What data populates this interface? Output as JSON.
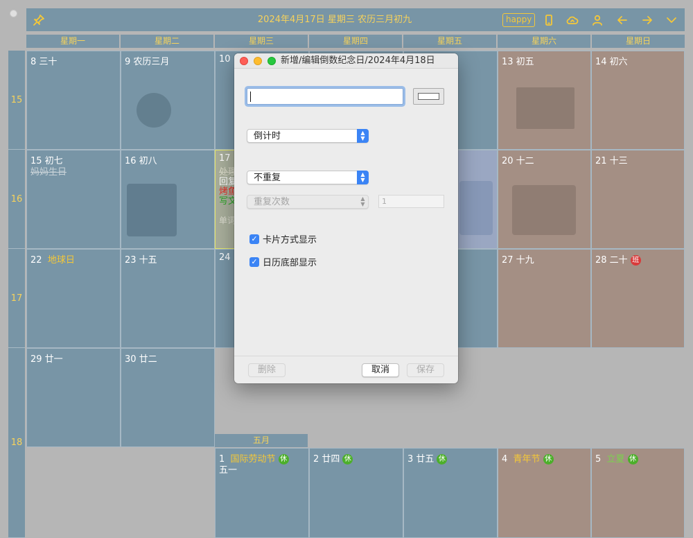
{
  "header": {
    "title": "2024年4月17日 星期三 农历三月初九",
    "happy_label": "happy",
    "icons": [
      "pin-icon",
      "phone-icon",
      "cloud-icon",
      "person-icon",
      "arrow-left-icon",
      "arrow-right-icon",
      "chevron-down-icon"
    ]
  },
  "weekdays": [
    "星期一",
    "星期二",
    "星期三",
    "星期四",
    "星期五",
    "星期六",
    "星期日"
  ],
  "weeks": [
    "15",
    "16",
    "17",
    "18"
  ],
  "cells": {
    "d8": "8  三十",
    "d9": "9  农历三月",
    "d10": "10",
    "d13": "13  初五",
    "d14": "14  初六",
    "d15": "15  初七",
    "d15_event": "妈妈生日",
    "d16": "16  初八",
    "d17": "17",
    "d17_e1": "处理",
    "d17_e2": "回复",
    "d17_e3": "烤鱼",
    "d17_e4": "写文",
    "d17_e5": "单词",
    "d20": "20  十二",
    "d21": "21  十三",
    "d22_num": "22",
    "d22_name": "地球日",
    "d23": "23  十五",
    "d24": "24",
    "d27": "27  十九",
    "d28": "28  二十",
    "d28_tag": "班",
    "d29": "29  廿一",
    "d30": "30  廿二",
    "may_label": "五月",
    "m1_num": "1",
    "m1_name": "国际劳动节",
    "m1_tag": "休",
    "m1_sub": "五一",
    "m2": "2  廿四",
    "m2_tag": "休",
    "m3": "3  廿五",
    "m3_tag": "休",
    "m4_num": "4",
    "m4_name": "青年节",
    "m4_tag": "休",
    "m5_num": "5",
    "m5_name": "立夏",
    "m5_tag": "休"
  },
  "dialog": {
    "title": "新增/编辑倒数纪念日/2024年4月18日",
    "name_value": "",
    "type_select": "倒计时",
    "repeat_select": "不重复",
    "repeat_count_select": "重复次数",
    "repeat_count_value": "1",
    "card_display_label": "卡片方式显示",
    "card_display_checked": true,
    "calendar_bottom_label": "日历底部显示",
    "calendar_bottom_checked": true,
    "delete_label": "删除",
    "cancel_label": "取消",
    "save_label": "保存"
  },
  "colors": {
    "cell_weekday": "#7895a6",
    "cell_weekend": "#a48f84",
    "accent_yellow": "#f5c838",
    "holiday_green": "#4caf2a",
    "work_red": "#d83a3a",
    "mac_blue": "#3b84f5"
  }
}
